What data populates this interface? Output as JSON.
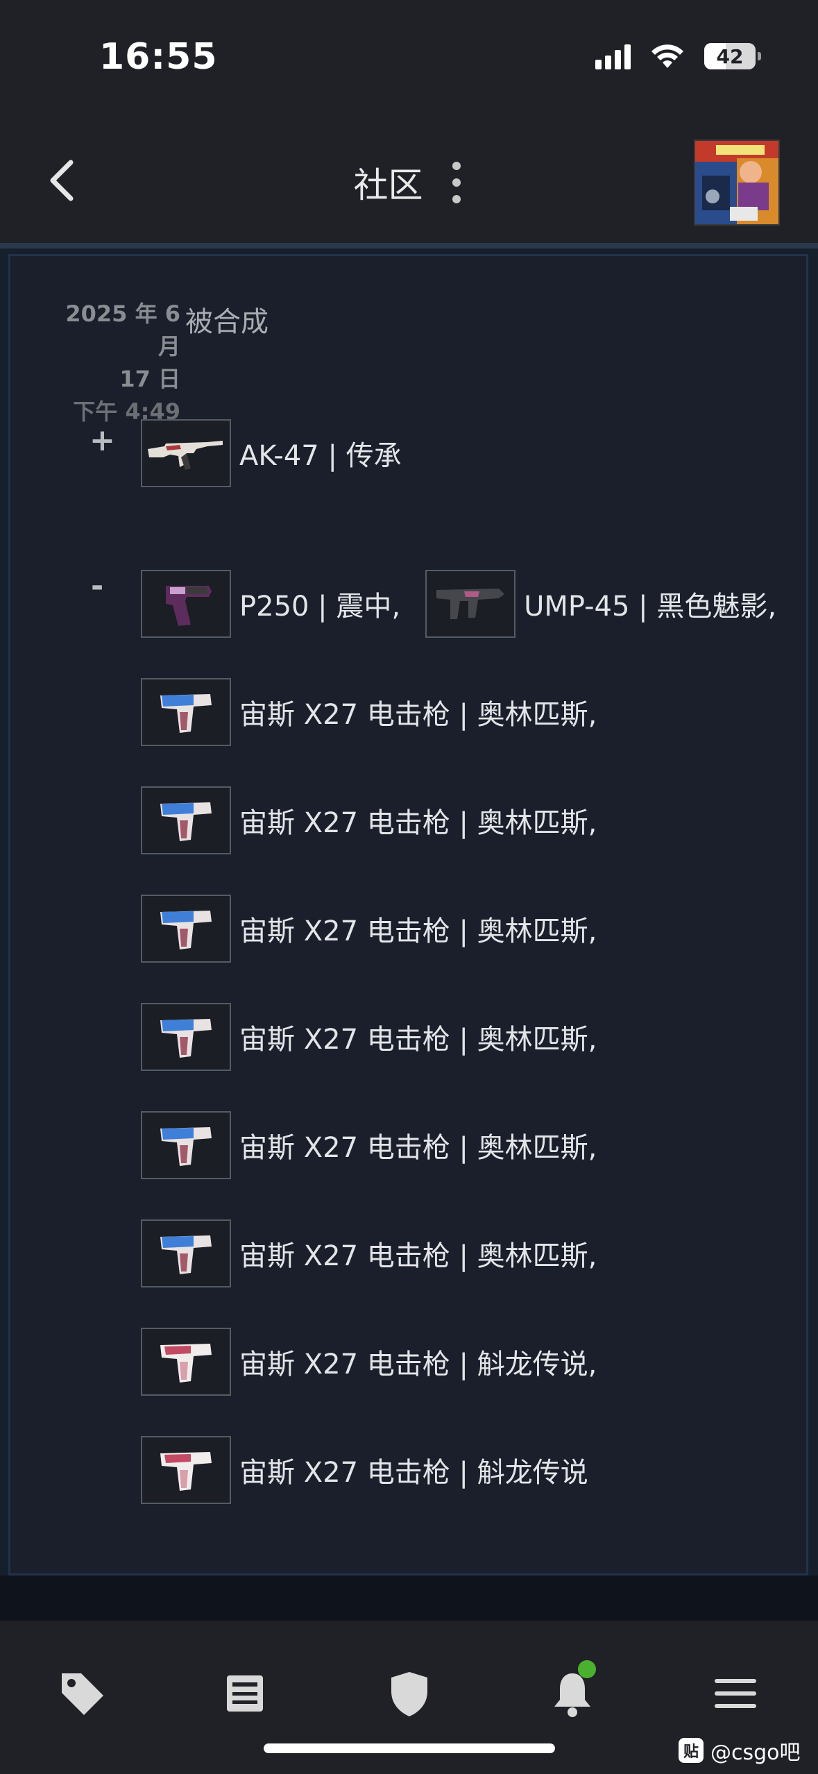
{
  "status_bar": {
    "time": "16:55",
    "battery": "42"
  },
  "nav": {
    "title": "社区"
  },
  "entry": {
    "date_line1": "2025 年 6 月",
    "date_line2": "17 日",
    "time": "下午 4:49",
    "action": "被合成",
    "added_sign": "+",
    "removed_sign": "-",
    "added": [
      {
        "label": "AK-47 | 传承",
        "icon": "ak47-icon"
      }
    ],
    "removed_first_row": [
      {
        "label": "P250 | 震中,",
        "icon": "p250-icon"
      },
      {
        "label": "UMP-45 | 黑色魅影,",
        "icon": "ump45-icon"
      }
    ],
    "removed": [
      {
        "label": "宙斯 X27 电击枪 | 奥林匹斯,"
      },
      {
        "label": "宙斯 X27 电击枪 | 奥林匹斯,"
      },
      {
        "label": "宙斯 X27 电击枪 | 奥林匹斯,"
      },
      {
        "label": "宙斯 X27 电击枪 | 奥林匹斯,"
      },
      {
        "label": "宙斯 X27 电击枪 | 奥林匹斯,"
      },
      {
        "label": "宙斯 X27 电击枪 | 奥林匹斯,"
      },
      {
        "label": "宙斯 X27 电击枪 | 斛龙传说,"
      },
      {
        "label": "宙斯 X27 电击枪 | 斛龙传说"
      }
    ]
  },
  "tabbar": {
    "items": [
      "tag-icon",
      "news-icon",
      "shield-icon",
      "bell-icon",
      "menu-icon"
    ],
    "notification_color": "#4cb02f"
  },
  "watermark": {
    "icon_text": "贴",
    "text": "@csgo吧"
  }
}
